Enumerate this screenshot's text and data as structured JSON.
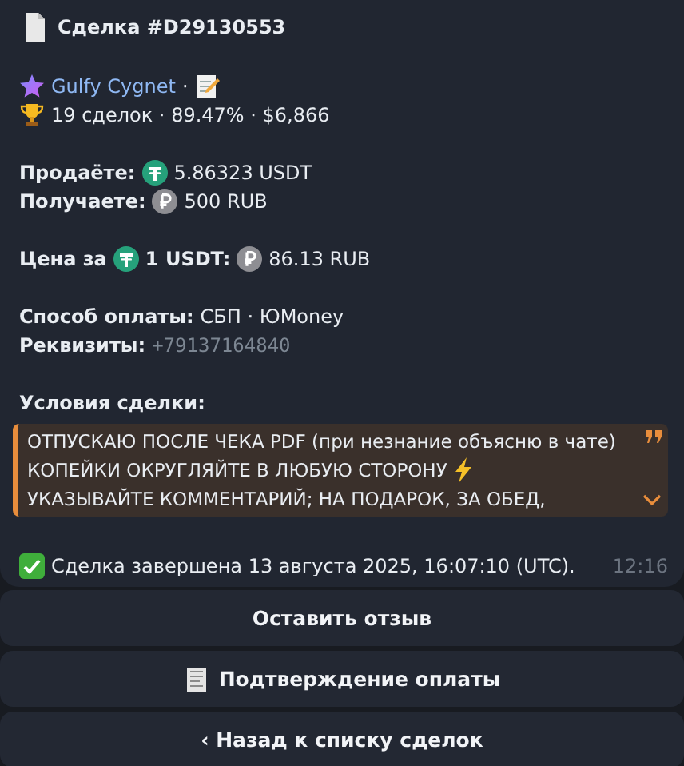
{
  "message": {
    "title": "Сделка #D29130553",
    "seller": {
      "name": "Gulfy Cygnet",
      "separator": "·",
      "stats": "19 сделок · 89.47% · $6,866"
    },
    "amounts": [
      {
        "label": "Продаёте:",
        "kind": "usdt",
        "value": "5.86323 USDT"
      },
      {
        "label": "Получаете:",
        "kind": "rub",
        "value": "500 RUB"
      }
    ],
    "price": {
      "label": "Цена за",
      "amount": "1 USDT:",
      "value": "86.13 RUB"
    },
    "payment": {
      "label": "Способ оплаты:",
      "value": "СБП · ЮMoney"
    },
    "details": {
      "label": "Реквизиты:",
      "value": "+79137164840"
    },
    "terms": {
      "heading": "Условия сделки:",
      "expanded": false,
      "lines": [
        {
          "text": "ОТПУСКАЮ ПОСЛЕ ЧЕКА PDF (при незнание объясню в чате)",
          "kind": "plain"
        },
        {
          "text": "КОПЕЙКИ ОКРУГЛЯЙТЕ В ЛЮБУЮ СТОРОНУ",
          "kind": "lightning"
        },
        {
          "text": "УКАЗЫВАЙТЕ КОММЕНТАРИЙ; НА ПОДАРОК, ЗА ОБЕД,",
          "kind": "plain"
        }
      ]
    },
    "status": {
      "text": "Сделка завершена 13 августа 2025, 16:07:10 (UTC).",
      "time": "12:16"
    }
  },
  "buttons": [
    {
      "label": "Оставить отзыв",
      "kind": "plain"
    },
    {
      "label": "Подтверждение оплаты",
      "kind": "receipt"
    },
    {
      "label": "‹ Назад к списку сделок",
      "kind": "plain"
    }
  ]
}
